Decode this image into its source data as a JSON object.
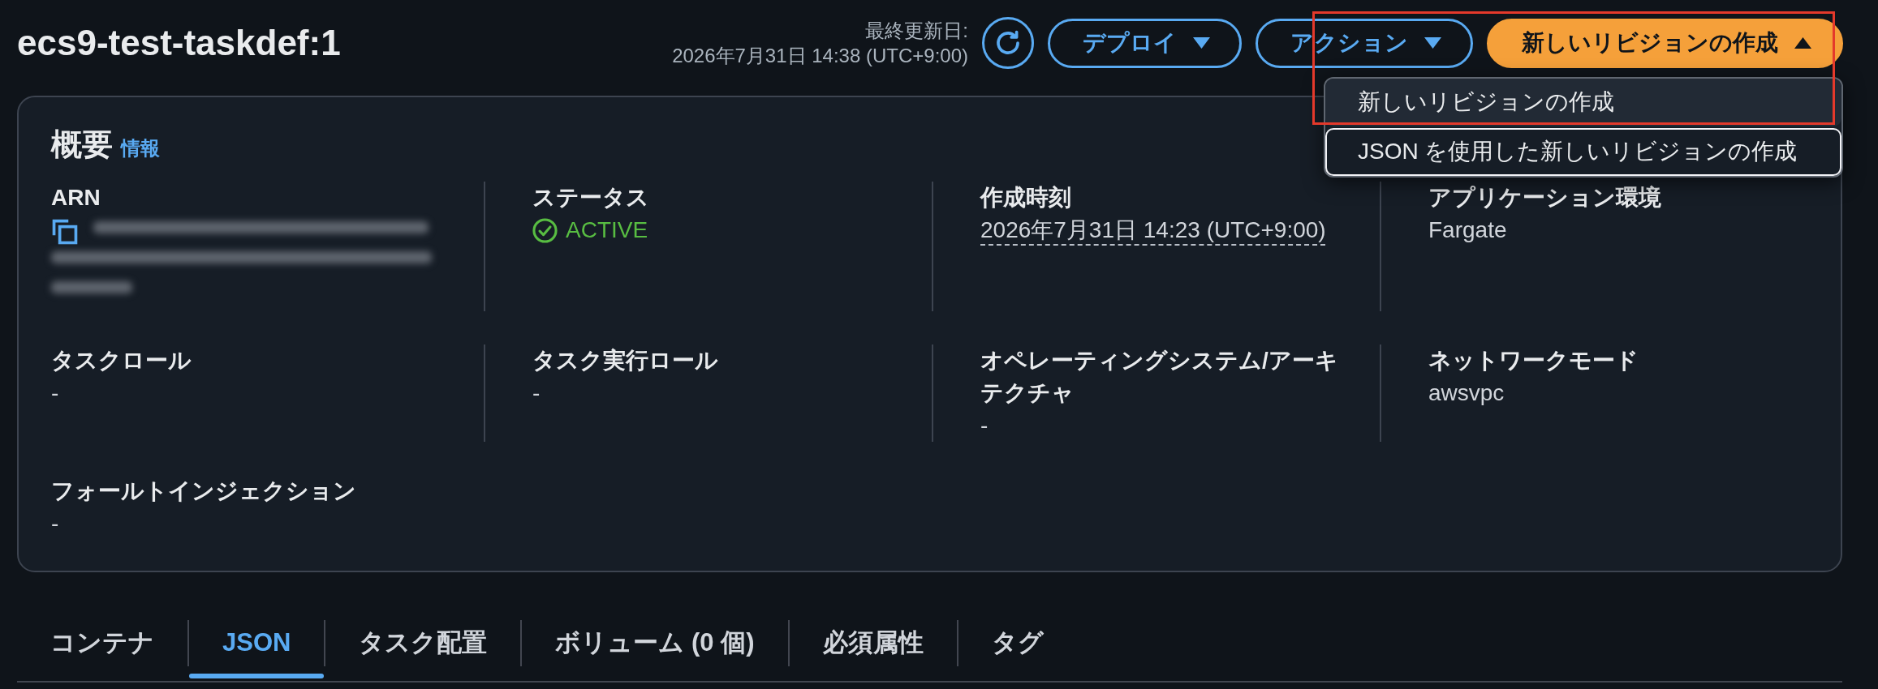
{
  "header": {
    "title": "ecs9-test-taskdef:1",
    "last_updated": {
      "label": "最終更新日:",
      "value": "2026年7月31日 14:38 (UTC+9:00)"
    },
    "buttons": [
      {
        "label": "デプロイ",
        "kind": "secondary",
        "expanded": false
      },
      {
        "label": "アクション",
        "kind": "secondary",
        "expanded": false
      },
      {
        "label": "新しいリビジョンの作成",
        "kind": "primary",
        "expanded": true,
        "menu": [
          {
            "label": "新しいリビジョンの作成",
            "hovered": true,
            "focused": false
          },
          {
            "label": "JSON を使用した新しいリビジョンの作成",
            "hovered": false,
            "focused": true
          }
        ]
      }
    ]
  },
  "annotations": [
    {
      "kind": "frame"
    }
  ],
  "overview": {
    "heading": "概要",
    "info_link": "情報",
    "fields": [
      {
        "label": "ARN",
        "kind": "redacted"
      },
      {
        "label": "ステータス",
        "kind": "status",
        "value": "ACTIVE"
      },
      {
        "label": "作成時刻",
        "kind": "datetime",
        "value": "2026年7月31日 14:23 (UTC+9:00)"
      },
      {
        "label": "アプリケーション環境",
        "kind": "text",
        "value": "Fargate"
      },
      {
        "label": "タスクロール",
        "kind": "text",
        "value": "-"
      },
      {
        "label": "タスク実行ロール",
        "kind": "text",
        "value": "-"
      },
      {
        "label": "オペレーティングシステム/アーキテクチャ",
        "kind": "text",
        "value": "-"
      },
      {
        "label": "ネットワークモード",
        "kind": "text",
        "value": "awsvpc"
      },
      {
        "label": "フォールトインジェクション",
        "kind": "text",
        "value": "-"
      }
    ]
  },
  "tabs": [
    {
      "label": "コンテナ",
      "selected": false
    },
    {
      "label": "JSON",
      "selected": true
    },
    {
      "label": "タスク配置",
      "selected": false
    },
    {
      "label": "ボリューム (0 個)",
      "selected": false
    },
    {
      "label": "必須属性",
      "selected": false
    },
    {
      "label": "タグ",
      "selected": false
    }
  ]
}
